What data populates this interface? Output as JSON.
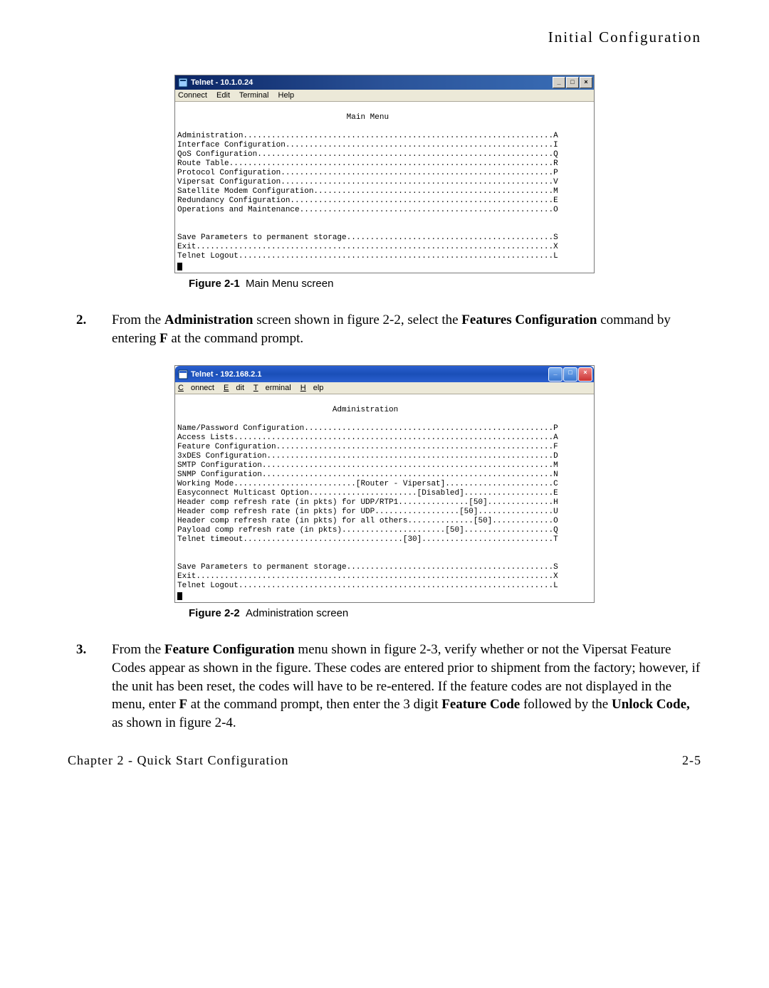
{
  "header": "Initial Configuration",
  "telnet1": {
    "title": "Telnet - 10.1.0.24",
    "menus": [
      "Connect",
      "Edit",
      "Terminal",
      "Help"
    ],
    "screen_title": "Main Menu",
    "items": [
      {
        "label": "Administration",
        "key": "A"
      },
      {
        "label": "Interface Configuration",
        "key": "I"
      },
      {
        "label": "QoS Configuration",
        "key": "Q"
      },
      {
        "label": "Route Table",
        "key": "R"
      },
      {
        "label": "Protocol Configuration",
        "key": "P"
      },
      {
        "label": "Vipersat Configuration",
        "key": "V"
      },
      {
        "label": "Satellite Modem Configuration",
        "key": "M"
      },
      {
        "label": "Redundancy Configuration",
        "key": "E"
      },
      {
        "label": "Operations and Maintenance",
        "key": "O"
      }
    ],
    "footer_items": [
      {
        "label": "Save Parameters to permanent storage",
        "key": "S"
      },
      {
        "label": "Exit",
        "key": "X"
      },
      {
        "label": "Telnet Logout",
        "key": "L"
      }
    ]
  },
  "caption1_label": "Figure 2-1",
  "caption1_text": "Main Menu screen",
  "step2_num": "2.",
  "step2_text_parts": {
    "a": "From the ",
    "b": "Administration",
    "c": " screen shown in figure 2-2, select the ",
    "d": "Features Configuration",
    "e": " command by entering ",
    "f": "F",
    "g": " at the command prompt."
  },
  "telnet2": {
    "title": "Telnet - 192.168.2.1",
    "menus": [
      "Connect",
      "Edit",
      "Terminal",
      "Help"
    ],
    "screen_title": "Administration",
    "items": [
      {
        "label": "Name/Password Configuration",
        "value": "",
        "key": "P"
      },
      {
        "label": "Access Lists",
        "value": "",
        "key": "A"
      },
      {
        "label": "Feature Configuration",
        "value": "",
        "key": "F"
      },
      {
        "label": "3xDES Configuration",
        "value": "",
        "key": "D"
      },
      {
        "label": "SMTP Configuration",
        "value": "",
        "key": "M"
      },
      {
        "label": "SNMP Configuration",
        "value": "",
        "key": "N"
      },
      {
        "label": "Working Mode",
        "value": "[Router - Vipersat]",
        "key": "C"
      },
      {
        "label": "Easyconnect Multicast Option",
        "value": "[Disabled]",
        "key": "E"
      },
      {
        "label": "Header comp refresh rate (in pkts) for UDP/RTP1",
        "value": "[50]",
        "key": "H"
      },
      {
        "label": "Header comp refresh rate (in pkts) for UDP",
        "value": "[50]",
        "key": "U"
      },
      {
        "label": "Header comp refresh rate (in pkts) for all others",
        "value": "[50]",
        "key": "O"
      },
      {
        "label": "Payload comp refresh rate (in pkts)",
        "value": "[50]",
        "key": "Q"
      },
      {
        "label": "Telnet timeout",
        "value": "[30]",
        "key": "T"
      }
    ],
    "footer_items": [
      {
        "label": "Save Parameters to permanent storage",
        "key": "S"
      },
      {
        "label": "Exit",
        "key": "X"
      },
      {
        "label": "Telnet Logout",
        "key": "L"
      }
    ]
  },
  "caption2_label": "Figure 2-2",
  "caption2_text": "Administration screen",
  "step3_num": "3.",
  "step3_text_parts": {
    "a": "From the ",
    "b": "Feature Configuration",
    "c": " menu shown in figure 2-3, verify whether or not the Vipersat Feature Codes appear as shown in the figure. These codes are entered prior to shipment from the factory; however, if the unit has been reset, the codes will have to be re-entered. If the feature codes are not displayed in the menu, enter ",
    "d": "F",
    "e": " at the command prompt, then enter the 3 digit ",
    "f": "Feature Code",
    "g": " followed by the ",
    "h": "Unlock Code,",
    "i": " as shown in figure 2-4."
  },
  "footer_left": "Chapter 2 - Quick Start Configuration",
  "footer_right": "2-5",
  "line_width": 81
}
